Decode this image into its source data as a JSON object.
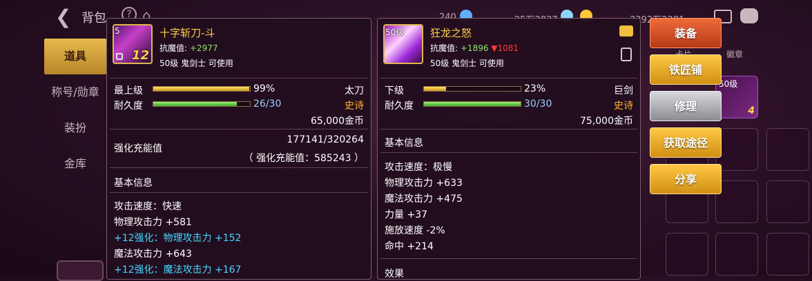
{
  "header": {
    "back_icon": "back-arrow-icon",
    "title": "背包",
    "help_icon": "question-icon",
    "shop_icon": "shop-icon",
    "resources": [
      {
        "icon": "diamond-icon",
        "value": "240",
        "color": "#5fb0ff"
      },
      {
        "icon": "crystal-icon",
        "value": "25万3837",
        "color": "#8fd6ff"
      },
      {
        "icon": "gold-coin-icon",
        "value": "3392万2381",
        "color": "#ffc83a"
      }
    ],
    "mail_icon": "mail-icon",
    "chat_icon": "chat-icon"
  },
  "left_tabs": [
    {
      "label": "道具",
      "active": true
    },
    {
      "label": "称号/勋章",
      "active": false
    },
    {
      "label": "装扮",
      "active": false
    },
    {
      "label": "金库",
      "active": false
    }
  ],
  "item1": {
    "level_tag": "5",
    "plus": "12",
    "name": "十字斩刀-斗",
    "resist_label": "抗魔值:",
    "resist_value": "+2977",
    "requirement": "50级 鬼剑士 可使用",
    "grade_label": "最上级",
    "grade_pct": "99%",
    "grade_fill": 0.99,
    "weapon_type": "太刀",
    "durability_label": "耐久度",
    "durability_val": "26/30",
    "durability_fill": 0.867,
    "rarity": "史诗",
    "price": "65,000金币",
    "enhance_label": "强化充能值",
    "enhance_val": "177141/320264",
    "enhance_sub": "（ 强化充能值：585243 ）",
    "basic_title": "基本信息",
    "stats": [
      {
        "text": "攻击速度：快速",
        "cyan": false
      },
      {
        "text": "物理攻击力 +581",
        "cyan": false
      },
      {
        "text": "+12强化：物理攻击力 +152",
        "cyan": true
      },
      {
        "text": "魔法攻击力 +643",
        "cyan": false
      },
      {
        "text": "+12强化：魔法攻击力 +167",
        "cyan": true
      }
    ]
  },
  "item2": {
    "level_tag": "50级",
    "name": "狂龙之怒",
    "resist_label": "抗魔值:",
    "resist_value": "+1896",
    "resist_diff": "▼1081",
    "requirement": "50级 鬼剑士 可使用",
    "grade_label": "下级",
    "grade_pct": "23%",
    "grade_fill": 0.23,
    "weapon_type": "巨剑",
    "durability_label": "耐久度",
    "durability_val": "30/30",
    "durability_fill": 1.0,
    "rarity": "史诗",
    "price": "75,000金币",
    "basic_title": "基本信息",
    "stats": [
      "攻击速度：极慢",
      "物理攻击力 +633",
      "魔法攻击力 +475",
      "力量 +37",
      "施放速度 -2%",
      "命中 +214"
    ],
    "effect_title": "效果"
  },
  "actions": [
    {
      "label": "装备",
      "style": "red"
    },
    {
      "label": "铁匠铺",
      "style": "gold"
    },
    {
      "label": "修理",
      "style": "silver"
    },
    {
      "label": "获取途径",
      "style": "gold"
    },
    {
      "label": "分享",
      "style": "gold"
    }
  ],
  "right_tabs": [
    "卡片",
    "徽章"
  ],
  "slot_tag": "50级",
  "slot_plus": "4"
}
